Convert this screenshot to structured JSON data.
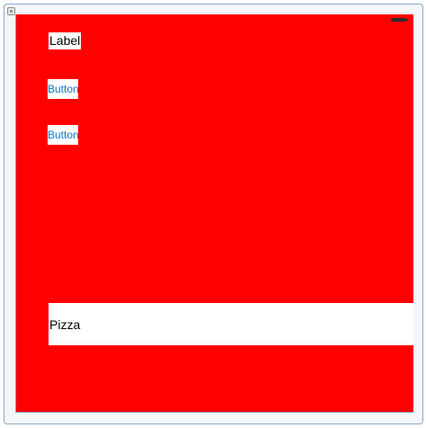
{
  "view": {
    "background_color": "#ff0000",
    "label_text": "Label",
    "buttons": [
      {
        "label": "Button"
      },
      {
        "label": "Button"
      }
    ],
    "text_field": {
      "value": "Pizza"
    },
    "button_text_color": "#1a73c9"
  }
}
